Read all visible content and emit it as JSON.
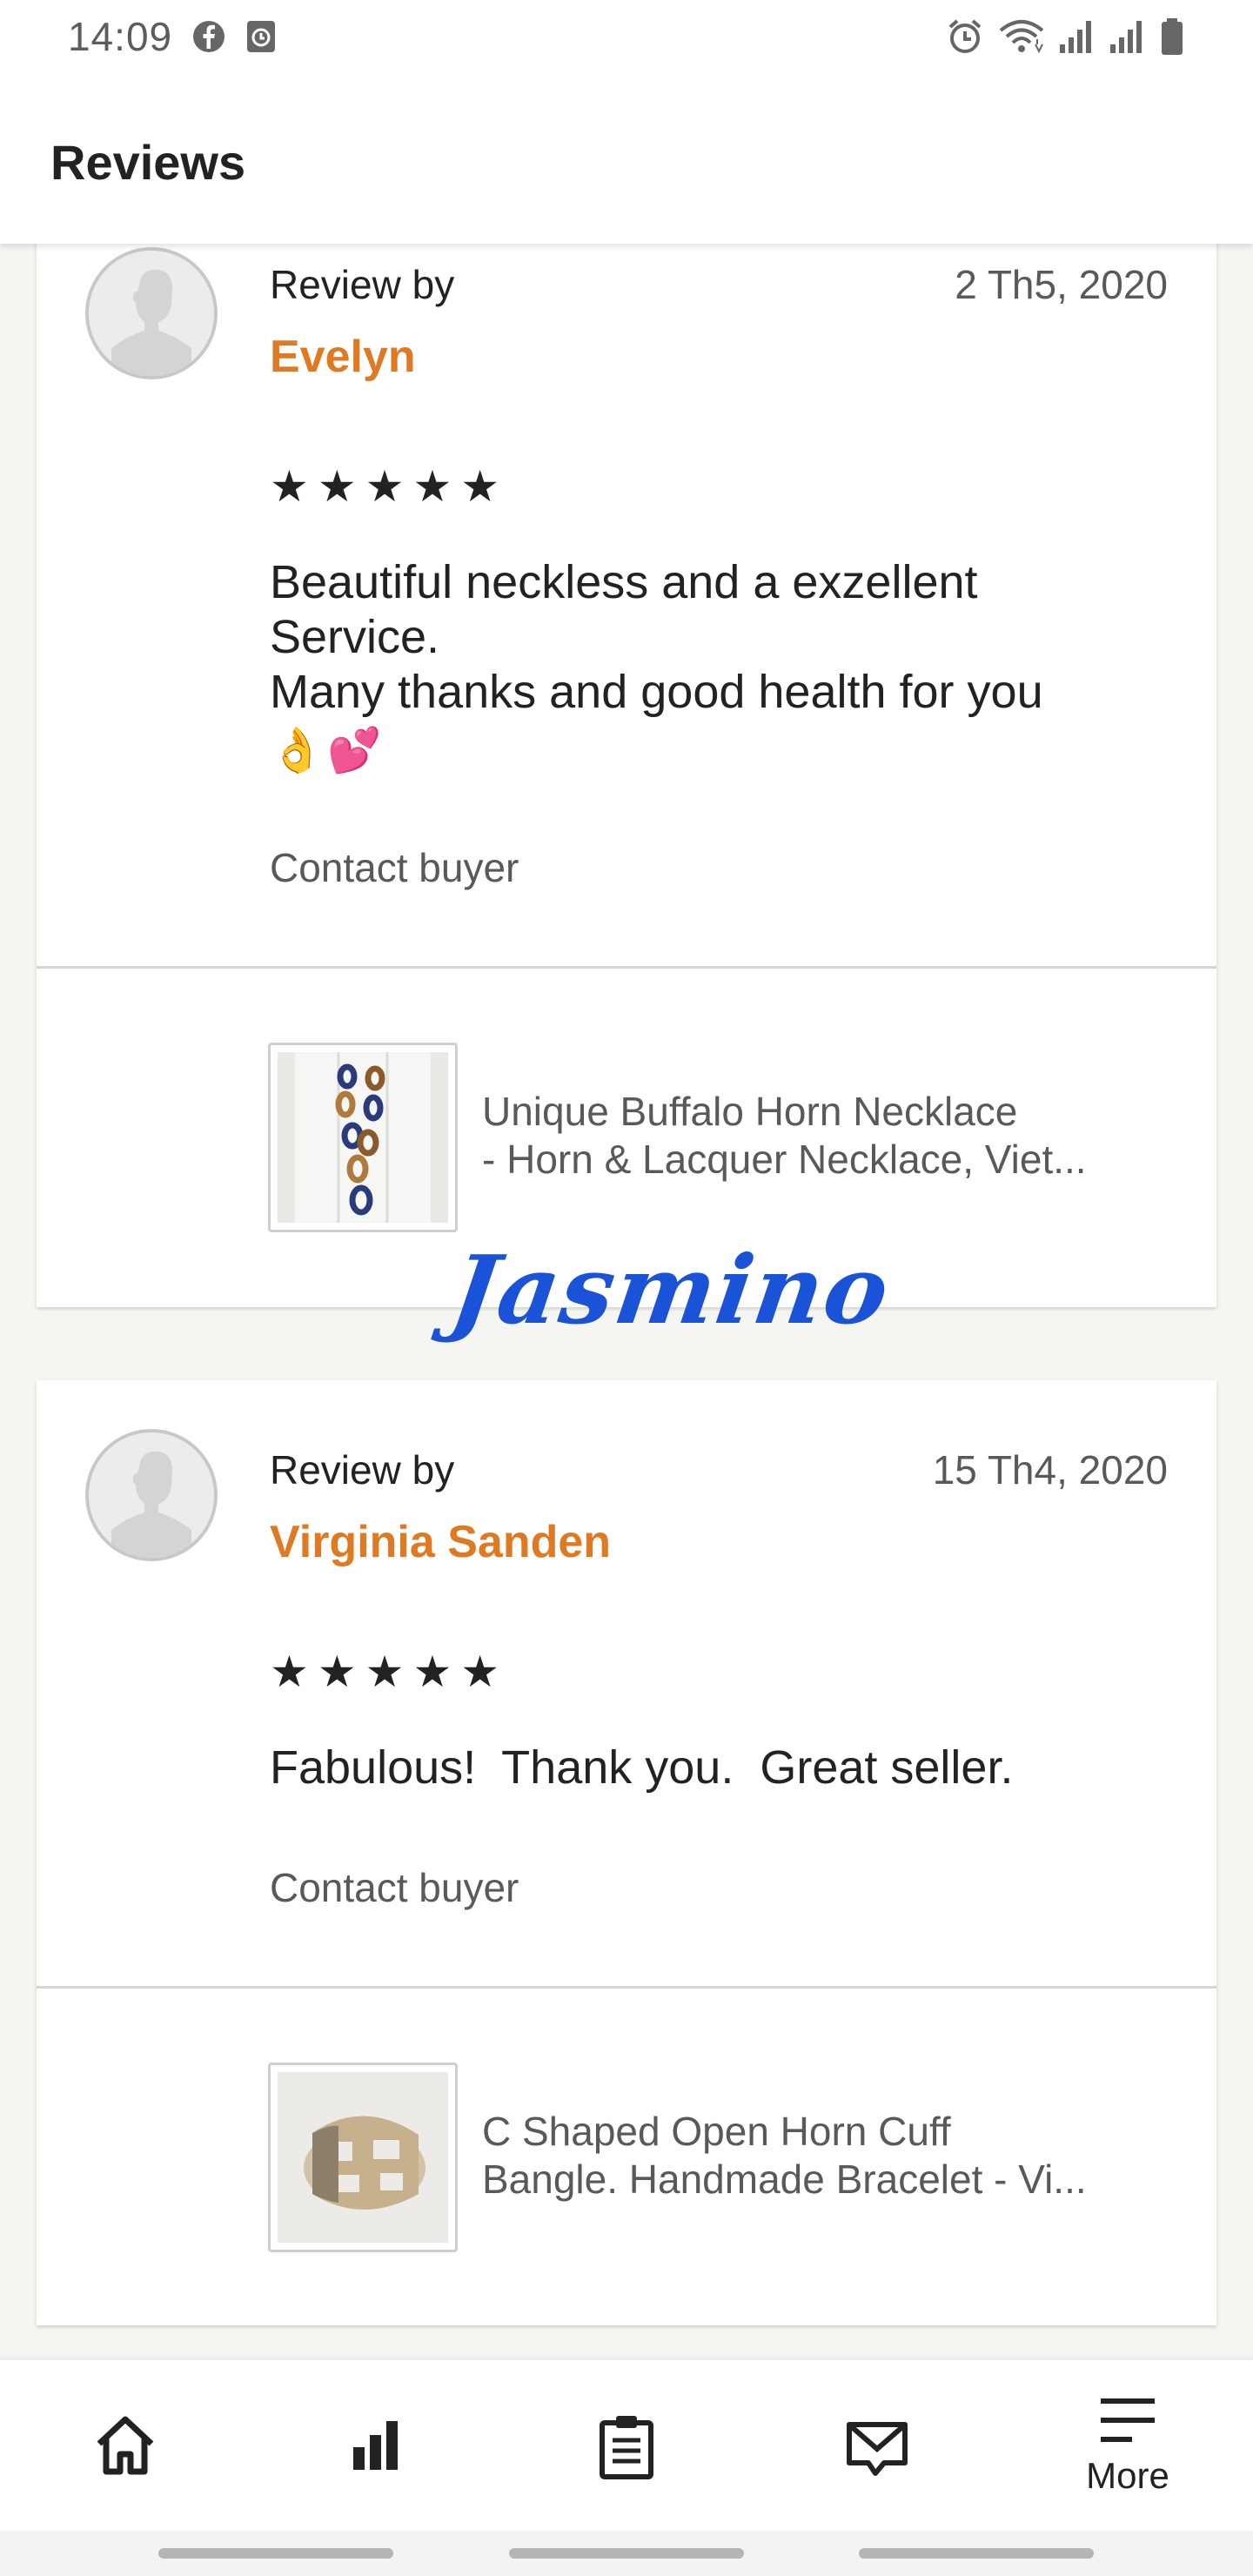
{
  "status_bar": {
    "time": "14:09",
    "left_icons": [
      "facebook-icon",
      "clock-app-icon"
    ],
    "right_icons": [
      "alarm-icon",
      "wifi-icon",
      "signal-icon",
      "signal-icon",
      "battery-icon"
    ]
  },
  "app_bar": {
    "title": "Reviews"
  },
  "reviews": [
    {
      "review_by_label": "Review by",
      "reviewer": "Evelyn",
      "date": "2 Th5, 2020",
      "stars": "★★★★★",
      "rating": 5,
      "text_lines": [
        "Beautiful neckless and a exzellent",
        "Service.",
        "Many thanks and good health for you"
      ],
      "emoji": [
        "👌",
        "💕"
      ],
      "contact_label": "Contact buyer",
      "listing": {
        "title_line1": "Unique Buffalo Horn Necklace",
        "title_line2": "- Horn & Lacquer Necklace, Viet..."
      }
    },
    {
      "review_by_label": "Review by",
      "reviewer": "Virginia Sanden",
      "date": "15 Th4, 2020",
      "stars": "★★★★★",
      "rating": 5,
      "text_lines": [
        "Fabulous!  Thank you.  Great seller."
      ],
      "contact_label": "Contact buyer",
      "listing": {
        "title_line1": "C Shaped Open Horn Cuff",
        "title_line2": "Bangle. Handmade Bracelet - Vi..."
      }
    }
  ],
  "watermark": "Jasmino",
  "bottom_nav": {
    "items": [
      {
        "icon": "home-icon"
      },
      {
        "icon": "stats-icon"
      },
      {
        "icon": "orders-clipboard-icon"
      },
      {
        "icon": "messages-icon"
      },
      {
        "icon": "menu-icon",
        "label": "More"
      }
    ]
  },
  "colors": {
    "accent": "#e07a22",
    "watermark": "#1a52d8"
  }
}
